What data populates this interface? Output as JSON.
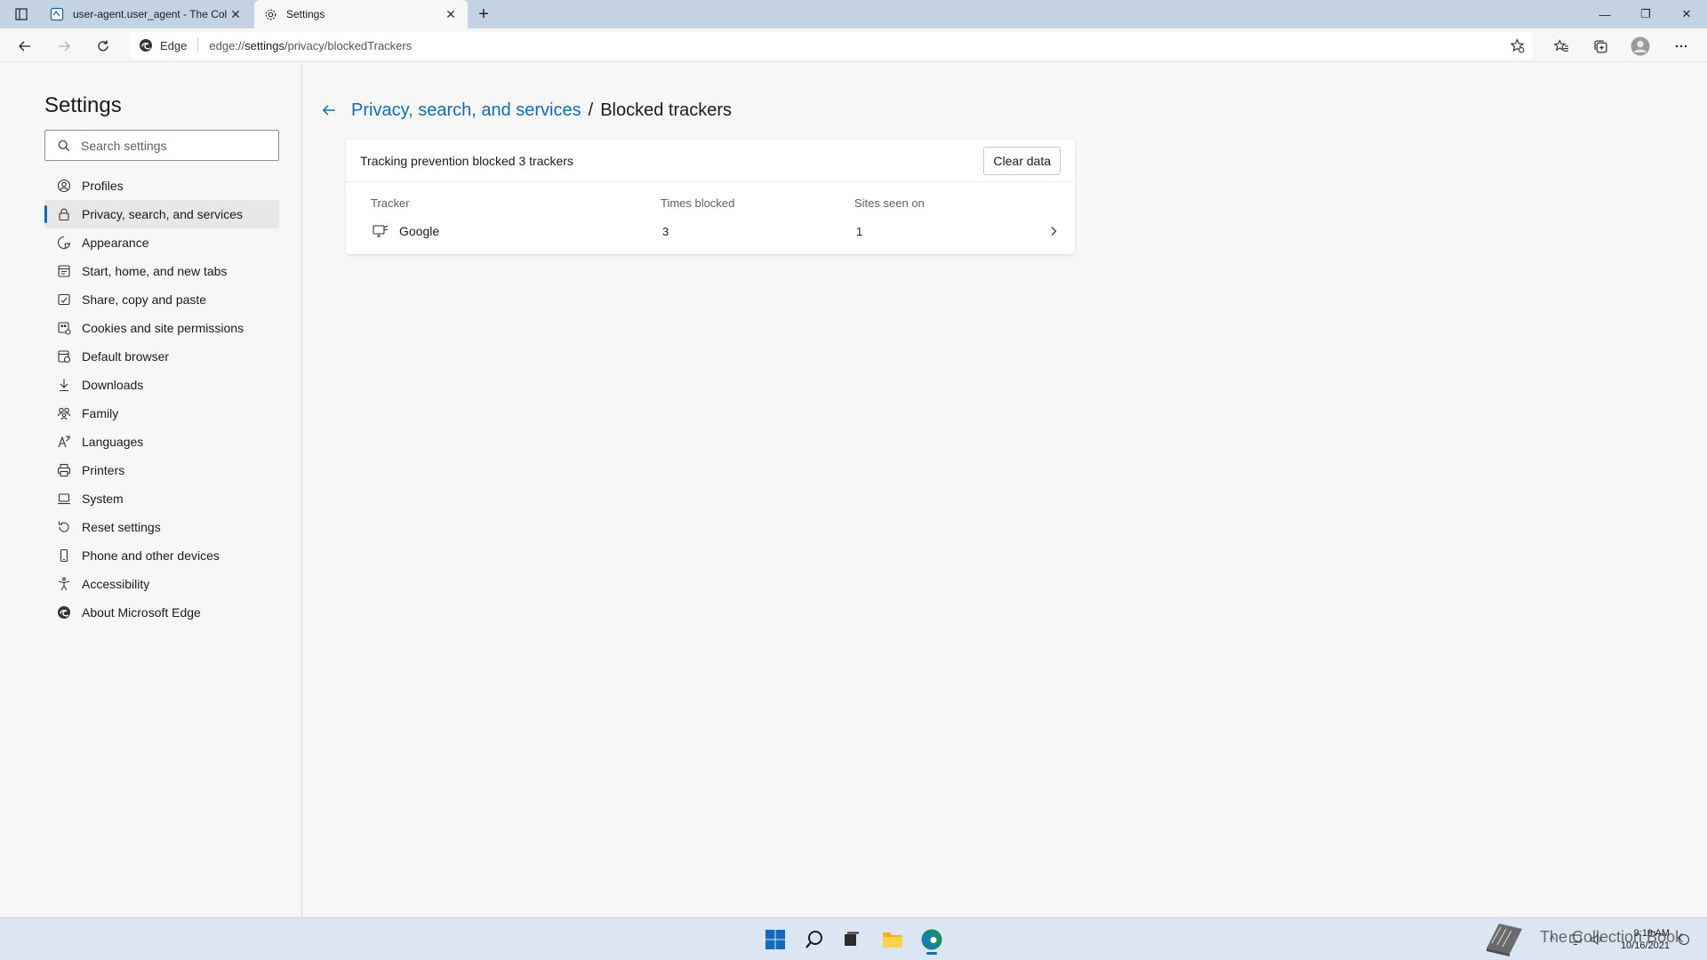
{
  "browser": {
    "tabs": [
      {
        "title": "user-agent.user_agent - The Coll",
        "icon": "book-favicon-icon",
        "active": false
      },
      {
        "title": "Settings",
        "icon": "gear-icon",
        "active": true
      }
    ],
    "new_tab_label": "+",
    "address": {
      "badge": "Edge",
      "url_prefix": "edge://",
      "url_host": "settings",
      "url_path": "/privacy/blockedTrackers"
    },
    "window_controls": {
      "minimize": "—",
      "restore": "❐",
      "close": "✕"
    }
  },
  "sidebar": {
    "title": "Settings",
    "search_placeholder": "Search settings",
    "items": [
      {
        "label": "Profiles",
        "icon": "profile-icon"
      },
      {
        "label": "Privacy, search, and services",
        "icon": "lock-icon",
        "selected": true
      },
      {
        "label": "Appearance",
        "icon": "appearance-icon"
      },
      {
        "label": "Start, home, and new tabs",
        "icon": "home-tabs-icon"
      },
      {
        "label": "Share, copy and paste",
        "icon": "share-icon"
      },
      {
        "label": "Cookies and site permissions",
        "icon": "cookies-icon"
      },
      {
        "label": "Default browser",
        "icon": "default-browser-icon"
      },
      {
        "label": "Downloads",
        "icon": "download-icon"
      },
      {
        "label": "Family",
        "icon": "family-icon"
      },
      {
        "label": "Languages",
        "icon": "languages-icon"
      },
      {
        "label": "Printers",
        "icon": "printer-icon"
      },
      {
        "label": "System",
        "icon": "system-icon"
      },
      {
        "label": "Reset settings",
        "icon": "reset-icon"
      },
      {
        "label": "Phone and other devices",
        "icon": "phone-icon"
      },
      {
        "label": "Accessibility",
        "icon": "accessibility-icon"
      },
      {
        "label": "About Microsoft Edge",
        "icon": "edge-logo-icon"
      }
    ]
  },
  "main": {
    "breadcrumb_parent": "Privacy, search, and services",
    "breadcrumb_sep": "/",
    "breadcrumb_current": "Blocked trackers",
    "card_title": "Tracking prevention blocked 3 trackers",
    "clear_button": "Clear data",
    "columns": {
      "tracker": "Tracker",
      "times_blocked": "Times blocked",
      "sites_seen_on": "Sites seen on"
    },
    "rows": [
      {
        "tracker": "Google",
        "times_blocked": "3",
        "sites_seen_on": "1"
      }
    ]
  },
  "taskbar": {
    "watermark_text": "The Collection Book",
    "time": "9:19 AM",
    "date": "10/16/2021"
  },
  "colors": {
    "accent": "#0f6cbd",
    "titlebar": "#c3d3e4",
    "taskbar": "#dbe6f2"
  }
}
